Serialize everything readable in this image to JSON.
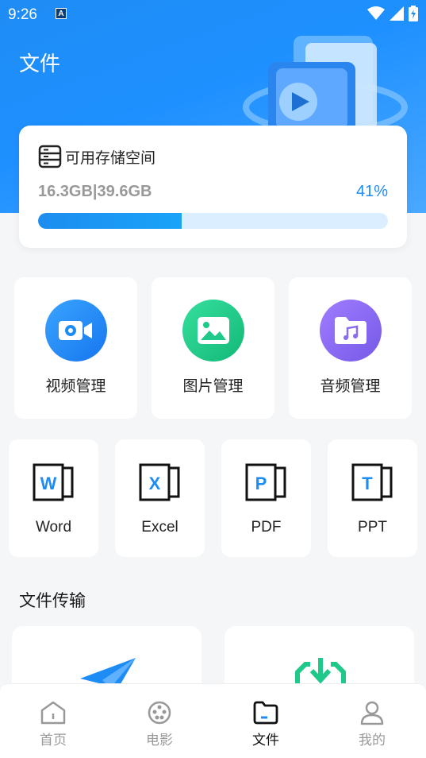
{
  "status_bar": {
    "time": "9:26",
    "notification_glyph": "A"
  },
  "header": {
    "title": "文件"
  },
  "storage": {
    "label": "可用存储空间",
    "usage": "16.3GB|39.6GB",
    "percent_text": "41%",
    "percent_value": 41
  },
  "categories": [
    {
      "label": "视频管理",
      "icon": "video-settings-icon",
      "color": "#1e8cf5"
    },
    {
      "label": "图片管理",
      "icon": "image-icon",
      "color": "#1ec98a"
    },
    {
      "label": "音频管理",
      "icon": "music-folder-icon",
      "color": "#8a6cf0"
    }
  ],
  "documents": [
    {
      "label": "Word",
      "letter": "W"
    },
    {
      "label": "Excel",
      "letter": "X"
    },
    {
      "label": "PDF",
      "letter": "P"
    },
    {
      "label": "PPT",
      "letter": "T"
    }
  ],
  "transfer": {
    "title": "文件传输"
  },
  "tabs": [
    {
      "label": "首页",
      "icon": "home-icon",
      "active": false
    },
    {
      "label": "电影",
      "icon": "film-reel-icon",
      "active": false
    },
    {
      "label": "文件",
      "icon": "folder-icon",
      "active": true
    },
    {
      "label": "我的",
      "icon": "user-icon",
      "active": false
    }
  ],
  "colors": {
    "accent": "#1e8cf5",
    "doc_letter": "#1e8cf5",
    "green": "#1ec98a"
  }
}
